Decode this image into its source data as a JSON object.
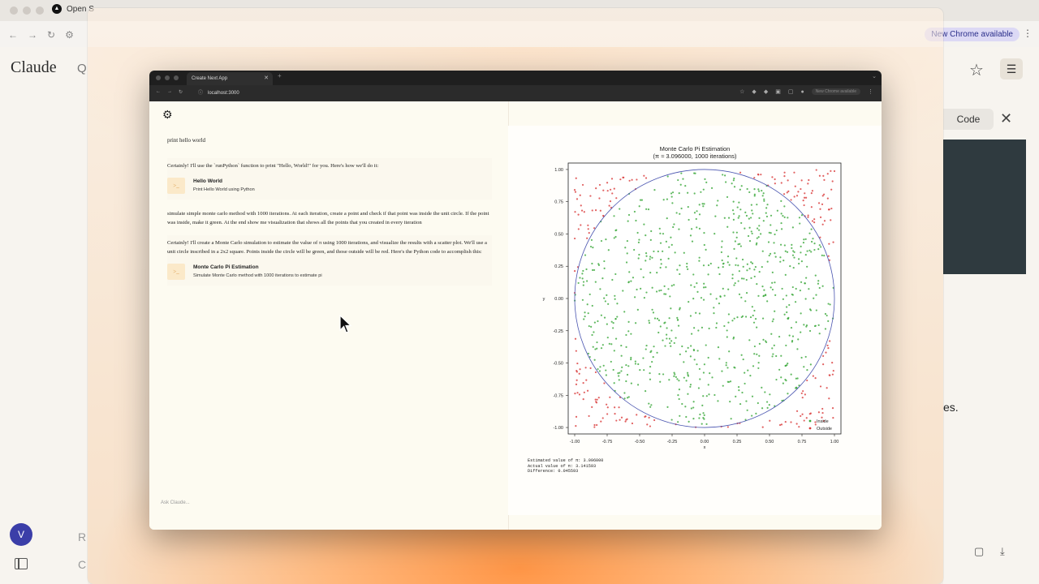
{
  "bg_app": {
    "tab_title": "Open S",
    "brand": "Claude",
    "search_glyph": "Q",
    "chrome_notice": "New Chrome available",
    "code_tab": "Code",
    "avatar_initial": "V",
    "partial_right_text": "es.",
    "partial_r": "R",
    "partial_c": "C"
  },
  "browser": {
    "tab_title": "Create Next App",
    "url": "localhost:3000",
    "chrome_notice": "New Chrome available"
  },
  "chat": {
    "messages": [
      {
        "role": "user",
        "text": "print hello world"
      },
      {
        "role": "assistant",
        "text": "Certainly! I'll use the `runPython` function to print \"Hello, World!\" for you. Here's how we'll do it:",
        "tool": {
          "title": "Hello World",
          "subtitle": "Print Hello World using Python"
        }
      },
      {
        "role": "user",
        "text": "simulate simple monte carlo method with 1000 iterations. At each iteration, create a point and check if that point was inside the unit circle. If the point was inside, make it green. At the end show me visualization that shows all the points that you created in every iteration"
      },
      {
        "role": "assistant",
        "text": "Certainly! I'll create a Monte Carlo simulation to estimate the value of π using 1000 iterations, and visualize the results with a scatter plot. We'll use a unit circle inscribed in a 2x2 square. Points inside the circle will be green, and those outside will be red. Here's the Python code to accomplish this:",
        "tool": {
          "title": "Monte Carlo Pi Estimation",
          "subtitle": "Simulate Monte Carlo method with 1000 iterations to estimate pi"
        }
      }
    ],
    "input_placeholder": "Ask Claude..."
  },
  "chart_data": {
    "type": "scatter",
    "title": "Monte Carlo Pi Estimation",
    "subtitle": "(π ≈ 3.096000, 1000 iterations)",
    "xlabel": "x",
    "ylabel": "y",
    "xlim": [
      -1.05,
      1.05
    ],
    "ylim": [
      -1.05,
      1.05
    ],
    "xticks": [
      "-1.00",
      "-0.75",
      "-0.50",
      "-0.25",
      "0.00",
      "0.25",
      "0.50",
      "0.75",
      "1.00"
    ],
    "yticks": [
      "-1.00",
      "-0.75",
      "-0.50",
      "-0.25",
      "0.00",
      "0.25",
      "0.50",
      "0.75",
      "1.00"
    ],
    "series": [
      {
        "name": "Inside",
        "color": "#3aa83a",
        "count": 774
      },
      {
        "name": "Outside",
        "color": "#d93a3a",
        "count": 226
      }
    ],
    "circle_color": "#4a55b0",
    "legend": "bottom-right"
  },
  "results": {
    "estimated": "Estimated value of π: 3.096000",
    "actual": "Actual value of π: 3.141593",
    "difference": "Difference: 0.045593"
  }
}
